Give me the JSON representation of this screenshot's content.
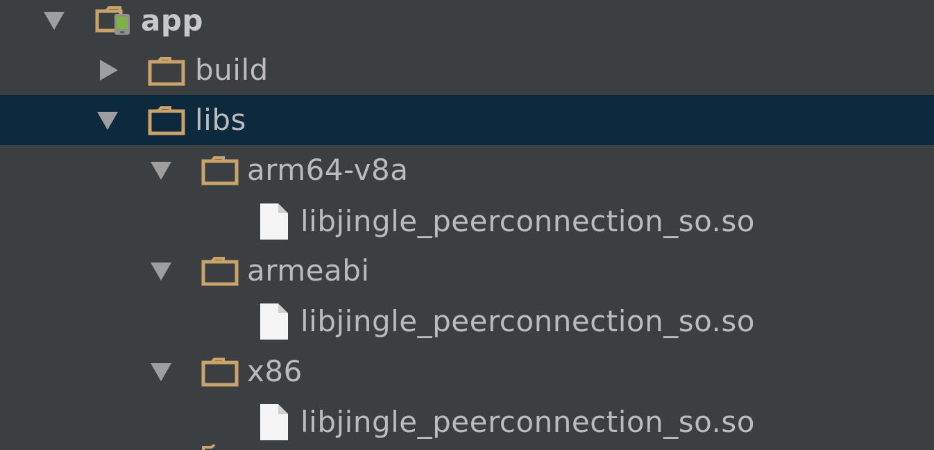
{
  "colors": {
    "background": "#3c3f41",
    "selection": "#0d293e",
    "text": "#bbbbbb",
    "folder": "#c9a36a",
    "file": "#f5f5f5",
    "arrow": "#9e9e9e"
  },
  "tree": {
    "root": {
      "label": "app",
      "expanded": true,
      "icon": "android-module-folder-icon"
    },
    "build": {
      "label": "build",
      "expanded": false,
      "icon": "folder-icon"
    },
    "libs": {
      "label": "libs",
      "expanded": true,
      "selected": true,
      "icon": "folder-icon"
    },
    "arm64": {
      "label": "arm64-v8a",
      "expanded": true,
      "icon": "folder-icon"
    },
    "arm64_file": {
      "label": "libjingle_peerconnection_so.so",
      "icon": "file-icon"
    },
    "armeabi": {
      "label": "armeabi",
      "expanded": true,
      "icon": "folder-icon"
    },
    "armeabi_file": {
      "label": "libjingle_peerconnection_so.so",
      "icon": "file-icon"
    },
    "x86": {
      "label": "x86",
      "expanded": true,
      "icon": "folder-icon"
    },
    "x86_file": {
      "label": "libjingle_peerconnection_so.so",
      "icon": "file-icon"
    }
  }
}
